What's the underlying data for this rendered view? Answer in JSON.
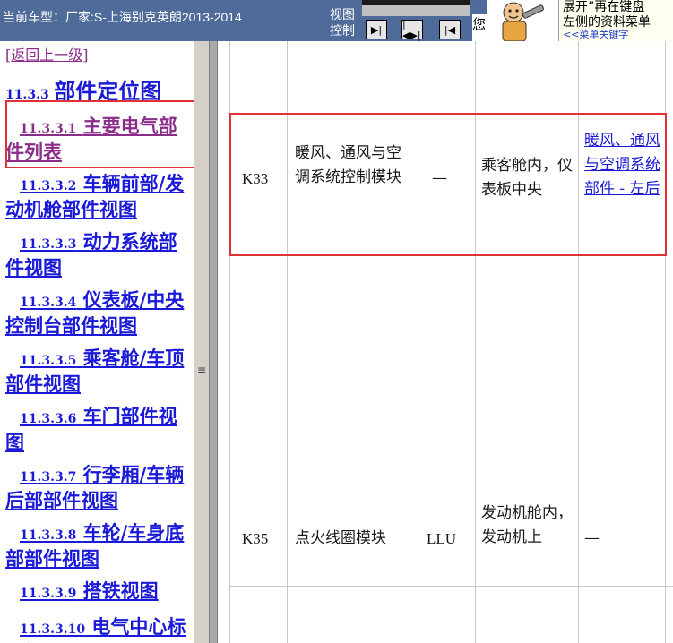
{
  "topbar": {
    "car_label": "当前车型：厂家:S-上海别克英朗2013-2014",
    "view_control_label": "视图控制",
    "buttons": [
      "▶|",
      "|◀▶|",
      "|◀"
    ],
    "nin": "您",
    "hint_line1": "展开”再在键盘",
    "hint_line2": "左侧的资料菜单",
    "hint_line3": "<<菜单关键字"
  },
  "nav": {
    "back": "[返回上一级]",
    "section_num": "11.3.3",
    "section_title": "部件定位图",
    "items": [
      {
        "num": "11.3.3.1",
        "label": "主要电气部件列表"
      },
      {
        "num": "11.3.3.2",
        "label": "车辆前部/发动机舱部件视图"
      },
      {
        "num": "11.3.3.3",
        "label": "动力系统部件视图"
      },
      {
        "num": "11.3.3.4",
        "label": "仪表板/中央控制台部件视图"
      },
      {
        "num": "11.3.3.5",
        "label": "乘客舱/车顶部件视图"
      },
      {
        "num": "11.3.3.6",
        "label": "车门部件视图"
      },
      {
        "num": "11.3.3.7",
        "label": "行李厢/车辆后部部件视图"
      },
      {
        "num": "11.3.3.8",
        "label": "车轮/车身底部部件视图"
      },
      {
        "num": "11.3.3.9",
        "label": "搭铁视图"
      },
      {
        "num": "11.3.3.10",
        "label": "电气中心标识视图"
      }
    ]
  },
  "table": {
    "rows": [
      {
        "code": "K33",
        "name": "暖风、通风与空调系统控制模块",
        "option": "—",
        "location": "乘客舱内，仪表板中央",
        "view": "暖风、通风与空调系统部件 - 左后"
      },
      {
        "code": "K35",
        "name": "点火线圈模块",
        "option": "LLU",
        "location": "发动机舱内，发动机上",
        "view": "—"
      }
    ]
  },
  "colors": {
    "topbar_bg": "#4f6b9a",
    "link": "#1a1ad8",
    "visited": "#8a2d8a",
    "highlight": "#e0303a"
  }
}
